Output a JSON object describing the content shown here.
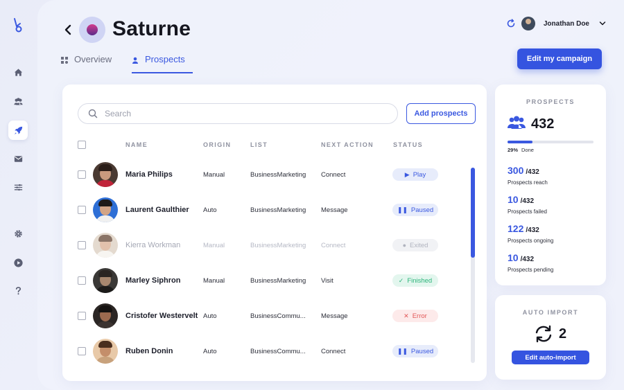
{
  "header": {
    "campaign_title": "Saturne",
    "user_name": "Jonathan Doe",
    "edit_campaign_label": "Edit my campaign"
  },
  "tabs": [
    {
      "label": "Overview",
      "active": false
    },
    {
      "label": "Prospects",
      "active": true
    }
  ],
  "sidebar": {
    "items": [
      "home-icon",
      "team-icon",
      "rocket-icon",
      "mail-icon",
      "filters-icon",
      "settings-icon",
      "play-icon",
      "help-icon"
    ],
    "active": "rocket-icon"
  },
  "search": {
    "placeholder": "Search"
  },
  "add_prospects_label": "Add prospects",
  "columns": [
    "NAME",
    "ORIGIN",
    "LIST",
    "NEXT ACTION",
    "STATUS"
  ],
  "rows": [
    {
      "name": "Maria Philips",
      "origin": "Manual",
      "list": "BusinessMarketing",
      "next_action": "Connect",
      "status": "Play",
      "status_icon": "▶"
    },
    {
      "name": "Laurent Gaulthier",
      "origin": "Auto",
      "list": "BusinessMarketing",
      "next_action": "Message",
      "status": "Paused",
      "status_icon": "❚❚"
    },
    {
      "name": "Kierra Workman",
      "origin": "Manual",
      "list": "BusinessMarketing",
      "next_action": "Connect",
      "status": "Exited",
      "status_icon": "●"
    },
    {
      "name": "Marley Siphron",
      "origin": "Manual",
      "list": "BusinessMarketing",
      "next_action": "Visit",
      "status": "Finished",
      "status_icon": "✓"
    },
    {
      "name": "Cristofer Westervelt",
      "origin": "Auto",
      "list": "BusinessCommu...",
      "next_action": "Message",
      "status": "Error",
      "status_icon": "✕"
    },
    {
      "name": "Ruben Donin",
      "origin": "Auto",
      "list": "BusinessCommu...",
      "next_action": "Connect",
      "status": "Paused",
      "status_icon": "❚❚"
    }
  ],
  "prospects_stats": {
    "title": "PROSPECTS",
    "total": "432",
    "done_percent": "29%",
    "done_fraction": 0.29,
    "done_label": "Done",
    "metrics": [
      {
        "value": "300",
        "of": "/432",
        "label": "Prospects reach"
      },
      {
        "value": "10",
        "of": "/432",
        "label": "Prospects failed"
      },
      {
        "value": "122",
        "of": "/432",
        "label": "Prospects ongoing"
      },
      {
        "value": "10",
        "of": "/432",
        "label": "Prospects pending"
      }
    ]
  },
  "auto_import": {
    "title": "AUTO IMPORT",
    "count": "2",
    "button_label": "Edit auto-import"
  },
  "colors": {
    "accent": "#3a58e0",
    "success": "#2cb47a",
    "error": "#e25757"
  }
}
